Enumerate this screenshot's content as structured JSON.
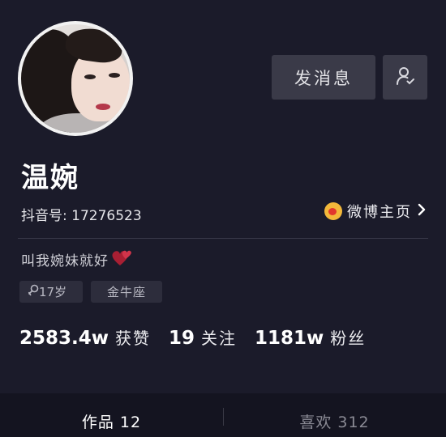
{
  "profile": {
    "name": "温婉",
    "account_label": "抖音号: 17276523",
    "weibo_label": "微博主页",
    "bio": "叫我婉妹就好",
    "tags": {
      "age": "17岁",
      "zodiac": "金牛座"
    }
  },
  "actions": {
    "message_label": "发消息"
  },
  "stats": {
    "likes": {
      "value": "2583.4w",
      "label": "获赞"
    },
    "following": {
      "value": "19",
      "label": "关注"
    },
    "followers": {
      "value": "1181w",
      "label": "粉丝"
    }
  },
  "tabs": {
    "works": "作品 12",
    "likes": "喜欢 312"
  },
  "colors": {
    "background": "#1b1b2a",
    "button": "#3a3a48",
    "tag": "#2d2d3c",
    "weibo": "#f3b83a",
    "heart": "#c0263a"
  },
  "icons": [
    "user-check-icon",
    "weibo-icon",
    "chevron-right-icon",
    "female-icon",
    "heart-icon"
  ]
}
